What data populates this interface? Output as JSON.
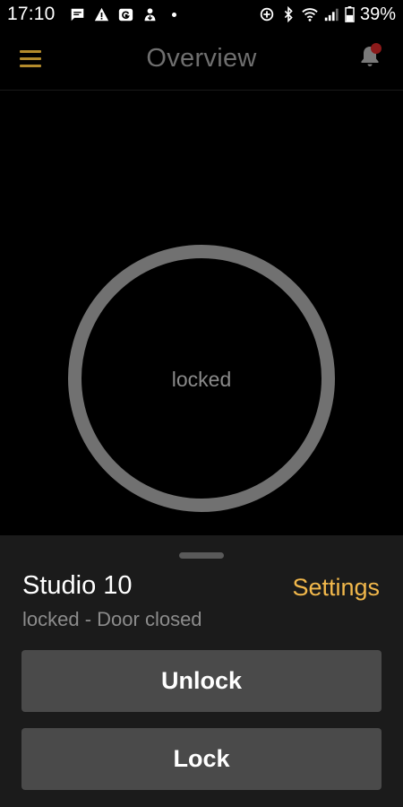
{
  "status_bar": {
    "time": "17:10",
    "battery_percent": "39%",
    "left_icons": [
      "message-icon",
      "warning-icon",
      "g-app-icon",
      "download-icon"
    ],
    "right_icons": [
      "sync-icon",
      "bluetooth-icon",
      "wifi-icon",
      "signal-icon",
      "battery-icon"
    ]
  },
  "app_bar": {
    "title": "Overview",
    "menu_icon": "menu-icon",
    "bell_icon": "bell-icon",
    "notification_dot_color": "#8b1a1a",
    "accent_color": "#b38b2c"
  },
  "lock_indicator": {
    "state_label": "locked",
    "ring_color": "#717171"
  },
  "device": {
    "name": "Studio 10",
    "status": "locked - Door closed",
    "settings_label": "Settings",
    "settings_color": "#f2b84b"
  },
  "actions": {
    "unlock_label": "Unlock",
    "lock_label": "Lock"
  }
}
